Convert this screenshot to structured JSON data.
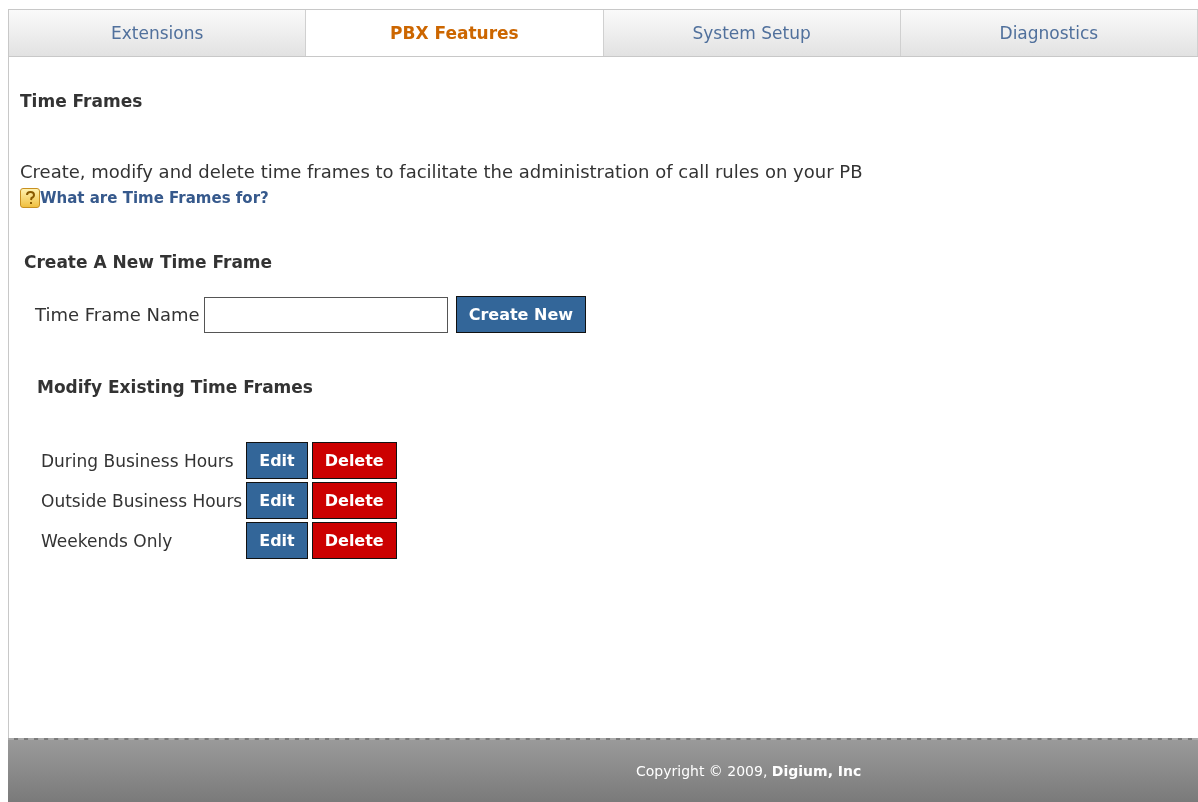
{
  "tabs": [
    {
      "label": "Extensions",
      "selected": false
    },
    {
      "label": "PBX Features",
      "selected": true
    },
    {
      "label": "System Setup",
      "selected": false
    },
    {
      "label": "Diagnostics",
      "selected": false
    }
  ],
  "page_title": "Time Frames",
  "description": "Create, modify and delete time frames to facilitate the administration of call rules on your PB",
  "help_link": "What are Time Frames for?",
  "create_section": {
    "heading": "Create A New Time Frame",
    "field_label": "Time Frame Name",
    "button": "Create New"
  },
  "modify_section": {
    "heading": "Modify Existing Time Frames",
    "items": [
      {
        "name": "During Business Hours",
        "edit_label": "Edit",
        "delete_label": "Delete"
      },
      {
        "name": "Outside Business Hours",
        "edit_label": "Edit",
        "delete_label": "Delete"
      },
      {
        "name": "Weekends Only",
        "edit_label": "Edit",
        "delete_label": "Delete"
      }
    ]
  },
  "footer": {
    "text": "Copyright © 2009, ",
    "company": "Digium, Inc"
  }
}
